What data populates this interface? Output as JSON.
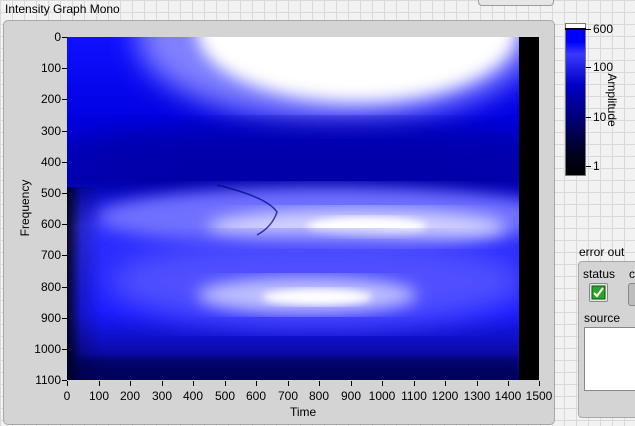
{
  "graph": {
    "title": "Intensity Graph Mono",
    "x_axis": {
      "title": "Time",
      "ticks": [
        "0",
        "100",
        "200",
        "300",
        "400",
        "500",
        "600",
        "700",
        "800",
        "900",
        "1000",
        "1100",
        "1200",
        "1300",
        "1400",
        "1500"
      ]
    },
    "y_axis": {
      "title": "Frequency",
      "ticks": [
        "0",
        "100",
        "200",
        "300",
        "400",
        "500",
        "600",
        "700",
        "800",
        "900",
        "1000",
        "1100"
      ]
    },
    "colors": {
      "low": "#000000",
      "mid": "#0000ff",
      "high": "#ffffff"
    }
  },
  "color_ramp": {
    "title": "Amplitude",
    "labels": [
      "600",
      "100",
      "10",
      "1"
    ],
    "scale": "log"
  },
  "error_out": {
    "title": "error out",
    "status_label": "status",
    "code_label": "c",
    "status_value": "ok",
    "source_label": "source",
    "source_value": ""
  },
  "chart_data": {
    "type": "heatmap",
    "xlabel": "Time",
    "ylabel": "Frequency",
    "xlim": [
      0,
      1500
    ],
    "ylim": [
      1100,
      0
    ],
    "colorbar_label": "Amplitude",
    "colorbar_range": [
      1,
      600
    ],
    "colorbar_scale": "log",
    "colormap": [
      "#000000",
      "#0000ff",
      "#ffffff"
    ]
  }
}
